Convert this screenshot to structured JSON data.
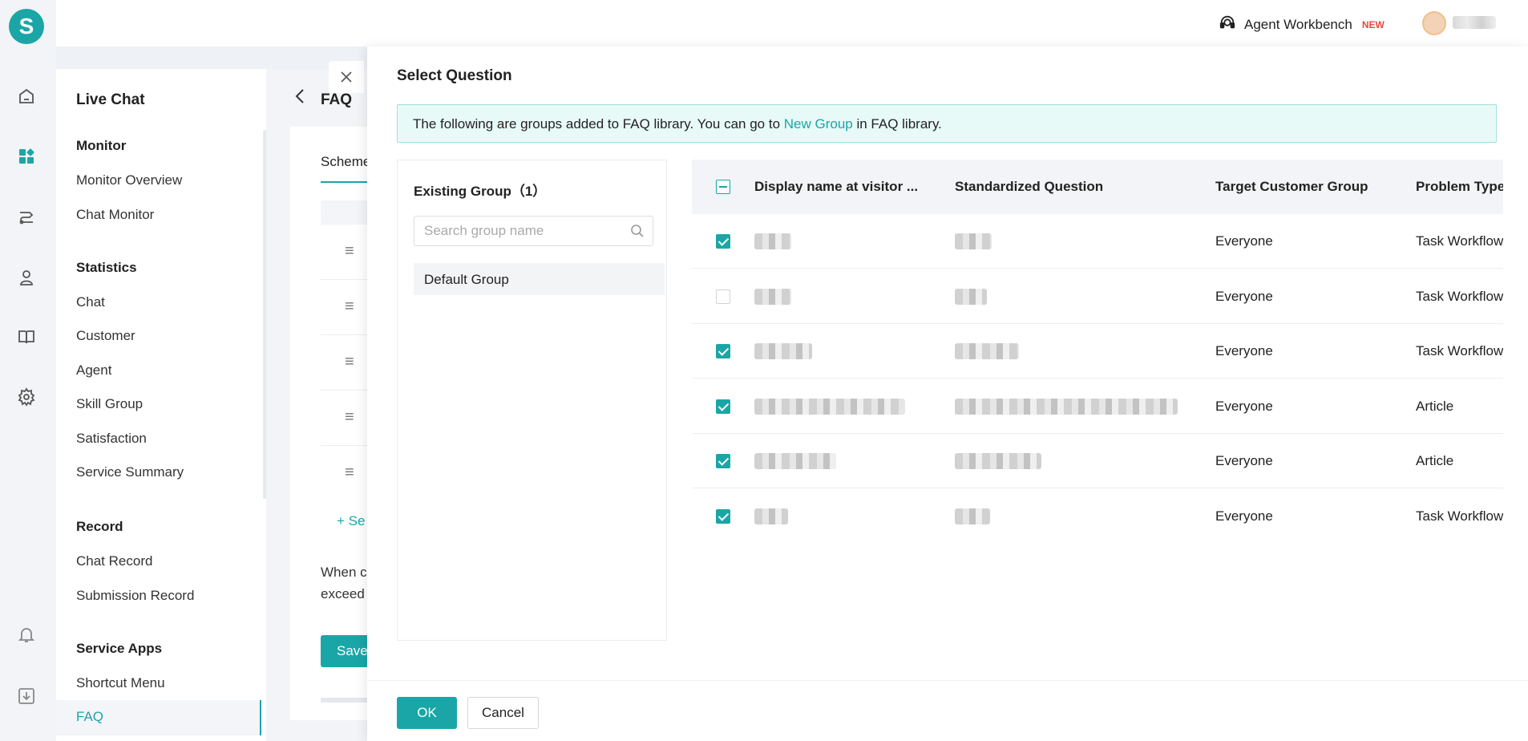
{
  "topbar": {
    "workbench_label": "Agent Workbench",
    "new_badge": "NEW"
  },
  "rail": {
    "logo_letter": "S",
    "icons": [
      "home-icon",
      "apps-icon",
      "routing-icon",
      "agent-icon",
      "book-icon",
      "gear-icon",
      "bell-icon",
      "download-icon"
    ]
  },
  "sidenav": {
    "title": "Live Chat",
    "sections": {
      "monitor": "Monitor",
      "statistics": "Statistics",
      "record": "Record",
      "service_apps": "Service Apps"
    },
    "items": {
      "monitor_overview": "Monitor Overview",
      "chat_monitor": "Chat Monitor",
      "chat": "Chat",
      "customer": "Customer",
      "agent": "Agent",
      "skill_group": "Skill Group",
      "satisfaction": "Satisfaction",
      "service_summary": "Service Summary",
      "chat_record": "Chat Record",
      "submission_record": "Submission Record",
      "shortcut_menu": "Shortcut Menu",
      "faq": "FAQ"
    }
  },
  "background_page": {
    "title": "FAQ",
    "tab": "Scheme",
    "add_label": "+ Se",
    "text_line1": "When c",
    "text_line2": "exceed",
    "save_label": "Save"
  },
  "drawer": {
    "title": "Select Question",
    "notice_prefix": "The following are groups added to FAQ library. You can go to ",
    "notice_link": "New Group",
    "notice_suffix": " in FAQ library.",
    "group_panel": {
      "title": "Existing Group（1）",
      "search_placeholder": "Search group name",
      "groups": [
        "Default Group"
      ]
    },
    "table": {
      "columns": [
        "Display name at visitor ...",
        "Standardized Question",
        "Target Customer Group",
        "Problem Type"
      ],
      "rows": [
        {
          "checked": true,
          "target": "Everyone",
          "type": "Task Workflow"
        },
        {
          "checked": false,
          "target": "Everyone",
          "type": "Task Workflow"
        },
        {
          "checked": true,
          "target": "Everyone",
          "type": "Task Workflow"
        },
        {
          "checked": true,
          "target": "Everyone",
          "type": "Article"
        },
        {
          "checked": true,
          "target": "Everyone",
          "type": "Article"
        },
        {
          "checked": true,
          "target": "Everyone",
          "type": "Task Workflow"
        }
      ]
    },
    "ok_label": "OK",
    "cancel_label": "Cancel"
  },
  "colors": {
    "accent": "#1aa6a6",
    "notice_bg": "#e8faf8",
    "badge_red": "#e9473f"
  }
}
